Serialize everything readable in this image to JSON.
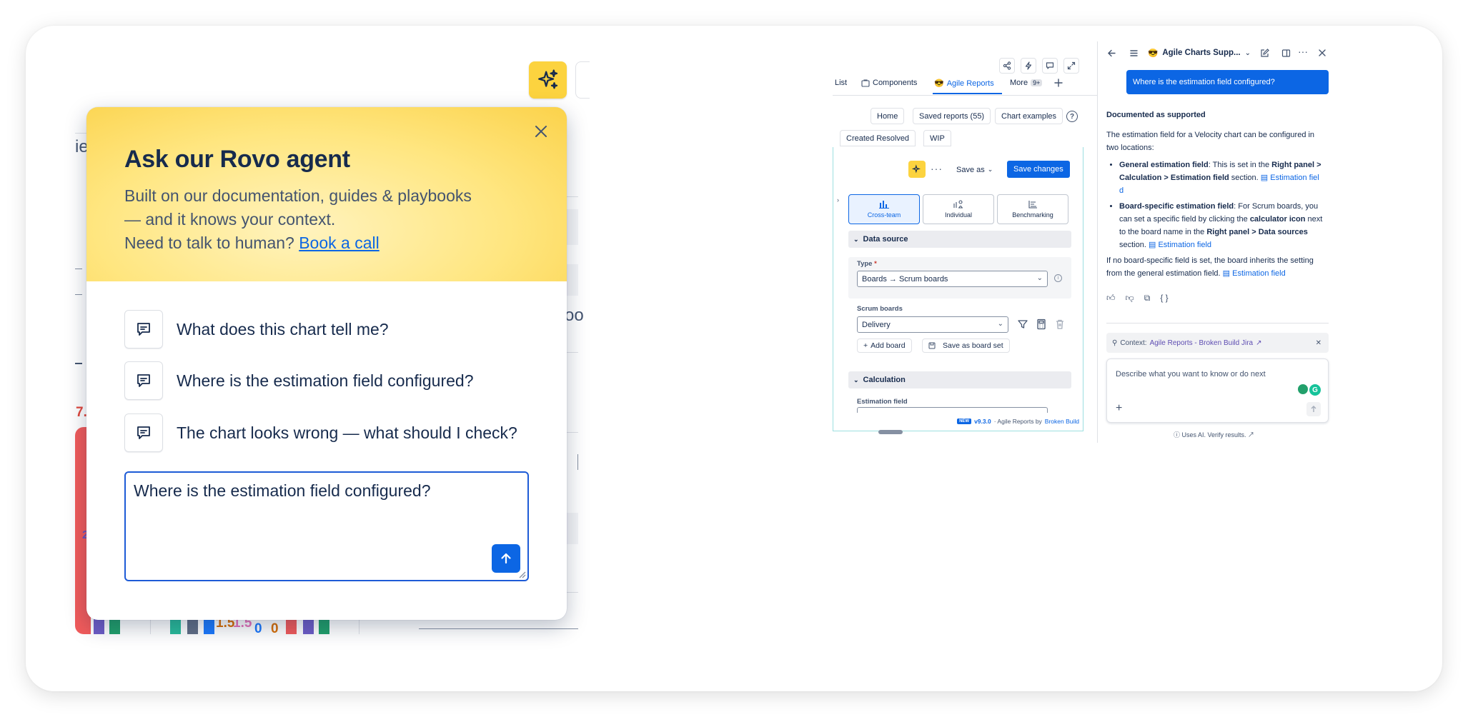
{
  "popup": {
    "title": "Ask our Rovo agent",
    "desc_line1": "Built on our documentation, guides & playbooks",
    "desc_line2": "— and it knows your context.",
    "desc_line3_prefix": "Need to talk to human?",
    "book_call_link": "Book a call",
    "suggestions": [
      "What does this chart tell me?",
      "Where is the estimation field configured?",
      "The chart looks wrong — what should I check?"
    ],
    "input_value": "Where is the estimation field configured?"
  },
  "background": {
    "left_edge_text": "ie",
    "right_edge_text": "oo",
    "red_label": "7.",
    "blue_label": "2",
    "bar_labels": [
      "1.5",
      "1.5",
      "0",
      "0"
    ]
  },
  "screenshot": {
    "tabs": [
      "List",
      "Components",
      "Agile Reports",
      "More"
    ],
    "more_badge": "9+",
    "subnav": [
      "Home",
      "Saved reports (55)",
      "Chart examples"
    ],
    "report_tabs": [
      "Created Resolved",
      "WIP"
    ],
    "save_as": "Save as",
    "save_changes": "Save changes",
    "segments": [
      "Cross-team",
      "Individual",
      "Benchmarking"
    ],
    "data_source_header": "Data source",
    "type_label": "Type",
    "type_value": "Boards → Scrum boards",
    "scrum_boards_label": "Scrum boards",
    "scrum_boards_value": "Delivery",
    "add_board": "Add board",
    "save_as_board_set": "Save as board set",
    "calculation_header": "Calculation",
    "estimation_field_label": "Estimation field",
    "footer_new": "NEW",
    "footer_version": "v9.3.0",
    "footer_text": "· Agile Reports by",
    "footer_vendor": "Broken Build"
  },
  "chat": {
    "title": "Agile Charts Supp...",
    "user_message": "Where is the estimation field configured?",
    "heading": "Documented as supported",
    "intro": "The estimation field for a Velocity chart can be configured in two locations:",
    "b1_bold": "General estimation field",
    "b1_text1": ": This is set in the ",
    "b1_bold2": "Right panel > Calculation > Estimation field",
    "b1_text2": " section.",
    "b1_link_a": "Estimation fiel",
    "b1_link_b": "d",
    "b2_bold": "Board-specific estimation field",
    "b2_text1": ": For Scrum boards, you can set a specific field by clicking the ",
    "b2_bold2": "calculator icon",
    "b2_text2": " next to the board name in the ",
    "b2_bold3": "Right panel > Data sources",
    "b2_text3": " section.",
    "b2_link": "Estimation field",
    "outro": "If no board-specific field is set, the board inherits the setting from the general estimation field.",
    "outro_link": "Estimation field",
    "context_label": "Context:",
    "context_link": "Agile Reports - Broken Build Jira",
    "input_placeholder": "Describe what you want to know or do next",
    "disclaimer": "Uses AI. Verify results."
  },
  "colors": {
    "accent": "#0c66e4",
    "rovo_yellow": "#fcd33f",
    "background_bar": "#f15b5b"
  }
}
